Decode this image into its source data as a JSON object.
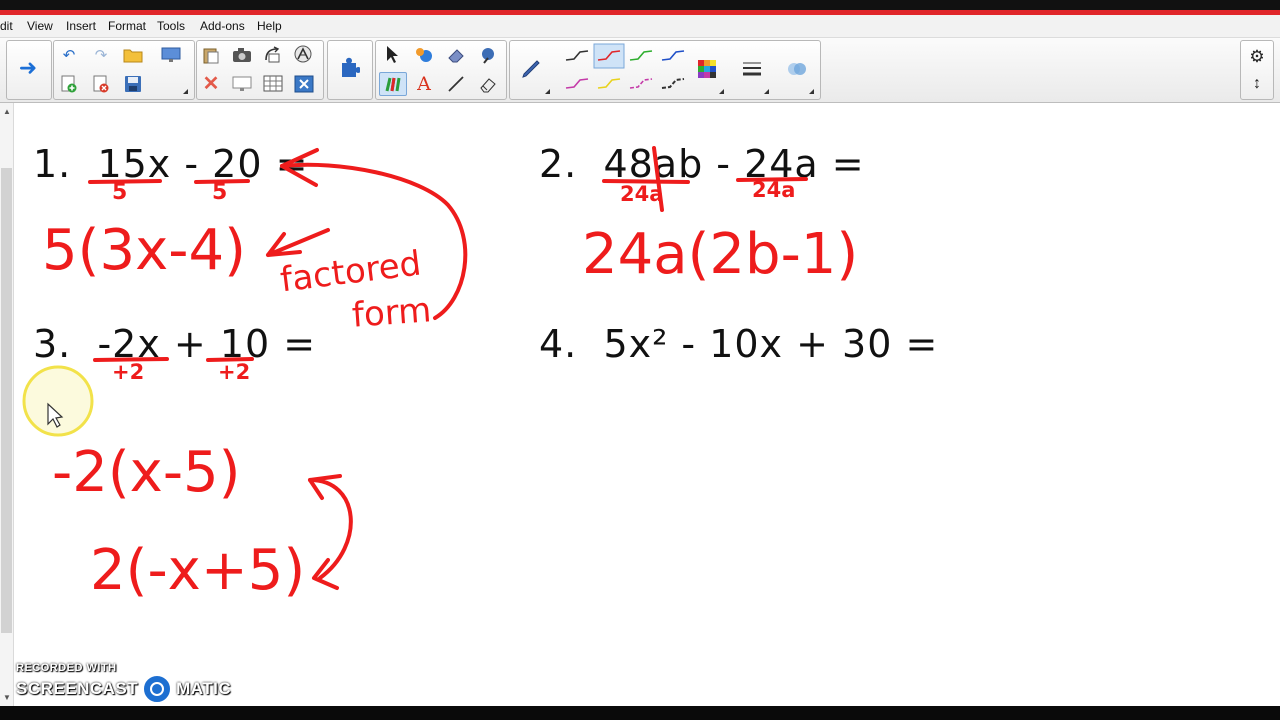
{
  "menu": {
    "items": [
      "dit",
      "View",
      "Insert",
      "Format",
      "Tools",
      "Add-ons",
      "Help"
    ]
  },
  "toolbar": {
    "icons": {
      "next_page": "arrow-right-icon",
      "undo": "undo-icon",
      "redo": "redo-icon",
      "open": "folder-icon",
      "add_page": "add-page-icon",
      "delete_page": "delete-page-icon",
      "save": "save-icon",
      "screen_shade": "screen-shade-icon",
      "paste": "paste-icon",
      "screen_capture": "camera-icon",
      "delete": "delete-icon",
      "full_screen": "full-screen-icon",
      "table": "table-icon",
      "fit": "fit-icon",
      "addon": "puzzle-icon",
      "select": "select-icon",
      "fill": "fill-icon",
      "eraser": "eraser-icon",
      "magic_pen": "magic-pen-icon",
      "pens": "pens-icon",
      "text": "text-icon",
      "line": "line-icon",
      "shape_eraser": "shape-eraser-icon",
      "pen": "pen-icon",
      "color_palette": "color-palette-icon",
      "line_style": "line-style-icon",
      "transparency": "transparency-icon",
      "settings": "gear-icon",
      "move_toolbar": "move-toolbar-icon"
    },
    "pen_colors": [
      "#333333",
      "#e0262a",
      "#2fae2f",
      "#2050c8",
      "#c43aa8",
      "#e8d21c",
      "#c43aa8",
      "#333333"
    ]
  },
  "problems": [
    {
      "number": "1.",
      "expression": "15x - 20 ="
    },
    {
      "number": "2.",
      "expression": "48ab - 24a ="
    },
    {
      "number": "3.",
      "expression": "-2x + 10 ="
    },
    {
      "number": "4.",
      "expression": "5x² - 10x + 30 ="
    }
  ],
  "handwriting": {
    "p1_div_a": "5",
    "p1_div_b": "5",
    "p1_answer": "5(3x-4)",
    "p1_note_line1": "factored",
    "p1_note_line2": "form",
    "p2_div_a": "24a",
    "p2_div_b": "24a",
    "p2_answer": "24a(2b-1)",
    "p3_div_a": "+2",
    "p3_div_b": "+2",
    "p3_answer_1": "-2(x-5)",
    "p3_answer_2": "2(-x+5)"
  },
  "colors": {
    "ink": "#ee1c1c",
    "accent_stripe": "#e0262a",
    "cursor_highlight": "#f2e24a"
  },
  "watermark": {
    "line1": "RECORDED WITH",
    "line2a": "SCREENCAST",
    "line2b": "MATIC"
  }
}
